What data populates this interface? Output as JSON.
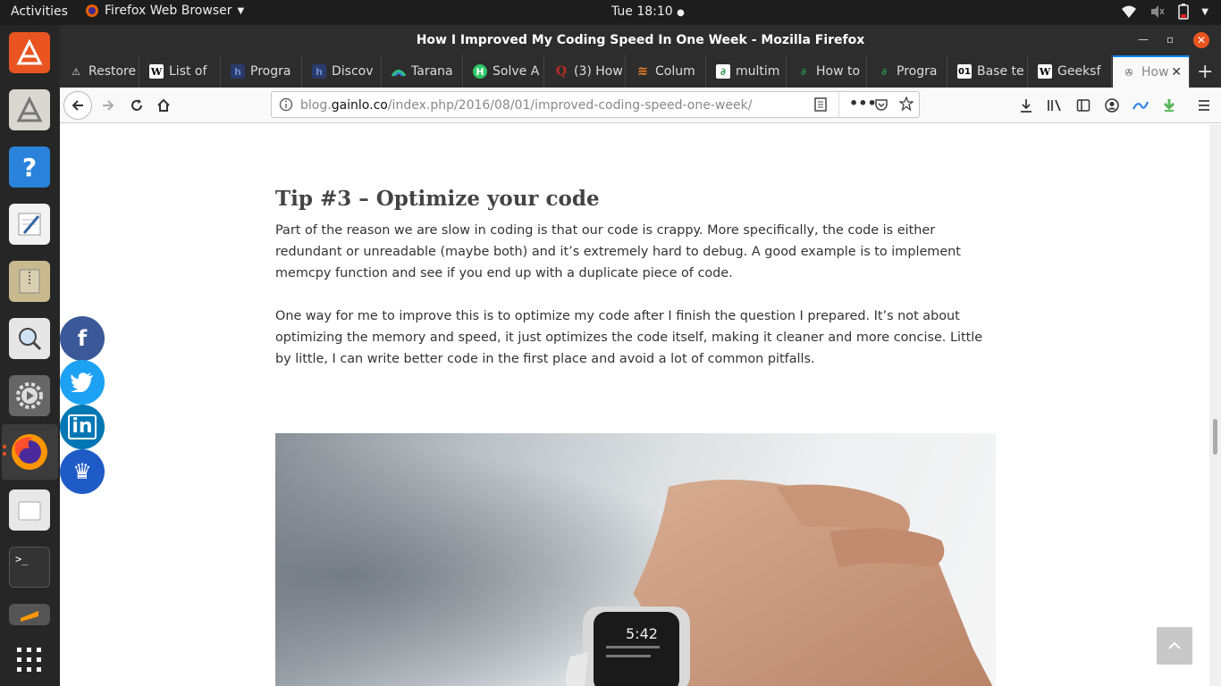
{
  "topbar": {
    "activities": "Activities",
    "app_name": "Firefox Web Browser",
    "clock": "Tue 18:10"
  },
  "window": {
    "title": "How I Improved My Coding Speed In One Week - Mozilla Firefox"
  },
  "tabs": [
    {
      "label": "Restore",
      "icon": "warning-icon"
    },
    {
      "label": "List of",
      "icon": "wikipedia-icon"
    },
    {
      "label": "Progra",
      "icon": "hackerrank-icon"
    },
    {
      "label": "Discov",
      "icon": "hackerrank-icon"
    },
    {
      "label": "Tarana",
      "icon": "tarana-icon"
    },
    {
      "label": "Solve A",
      "icon": "hackerrank-h-icon"
    },
    {
      "label": "(3) How",
      "icon": "quora-icon"
    },
    {
      "label": "Colum",
      "icon": "stackoverflow-icon"
    },
    {
      "label": "multim",
      "icon": "geeksforgeeks-icon"
    },
    {
      "label": "How to",
      "icon": "geeksforgeeks-icon"
    },
    {
      "label": "Progra",
      "icon": "geeksforgeeks-icon"
    },
    {
      "label": "Base te",
      "icon": "base-01-icon"
    },
    {
      "label": "Geeksf",
      "icon": "wikipedia-icon"
    },
    {
      "label": "How",
      "icon": "gainlo-icon"
    }
  ],
  "urlbar": {
    "prefix": "blog.",
    "domain": "gainlo.co",
    "path": "/index.php/2016/08/01/improved-coding-speed-one-week/"
  },
  "article": {
    "heading": "Tip #3 – Optimize your code",
    "paragraph1": "Part of the reason we are slow in coding is that our code is crappy. More specifically, the code is either redundant or unreadable (maybe both) and it’s extremely hard to debug. A good example is to implement memcpy function and see if you end up with a duplicate piece of code.",
    "paragraph2": "One way for me to improve this is to optimize my code after I finish the question I prepared. It’s not about optimizing the memory and speed, it just optimizes the code itself, making it cleaner and more concise. Little by little, I can write better code in the first place and avoid a lot of common pitfalls."
  },
  "watch_face": {
    "time": "5:42"
  },
  "social": [
    {
      "name": "facebook",
      "glyph": "f",
      "color": "#3b5998"
    },
    {
      "name": "twitter",
      "glyph": "t",
      "color": "#1da1f2"
    },
    {
      "name": "linkedin",
      "glyph": "in",
      "color": "#0077b5"
    },
    {
      "name": "crown",
      "glyph": "♛",
      "color": "#1e5bc6"
    }
  ],
  "colors": {
    "accent": "#0a84ff",
    "ubuntu_orange": "#e95420"
  }
}
